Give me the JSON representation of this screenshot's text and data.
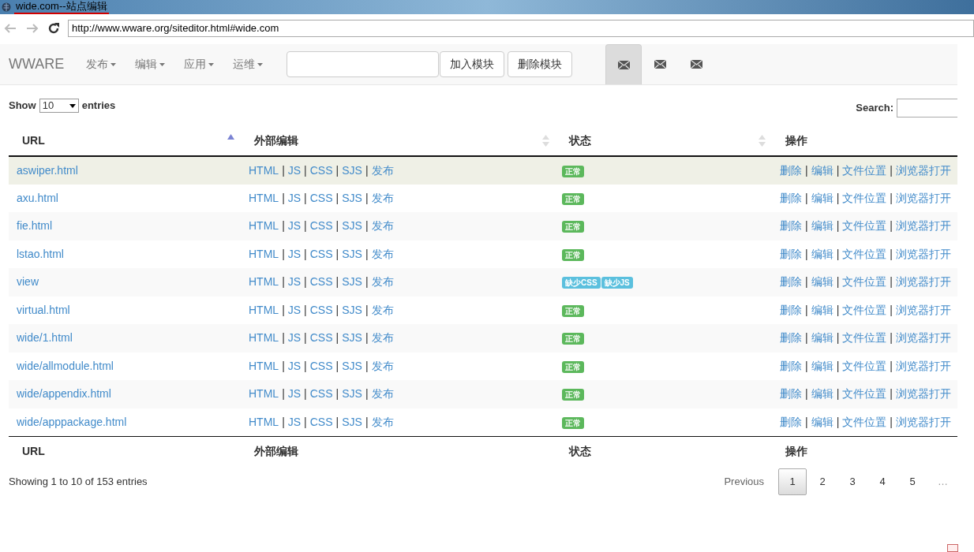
{
  "window": {
    "title": "wide.com--站点编辑"
  },
  "browser": {
    "url": "http://www.wware.org/siteditor.html#wide.com"
  },
  "navbar": {
    "brand": "WWARE",
    "menus": [
      "发布",
      "编辑",
      "应用",
      "运维"
    ],
    "buttons": [
      "加入模块",
      "删除模块"
    ],
    "icon_tabs": [
      {
        "selected": true
      },
      {
        "selected": false
      },
      {
        "selected": false
      }
    ]
  },
  "table_controls": {
    "show_label": "Show",
    "page_size": "10",
    "entries_label": "entries",
    "search_label": "Search:"
  },
  "table": {
    "columns": [
      {
        "label": "URL",
        "sortable": true,
        "sorted": true
      },
      {
        "label": "外部编辑",
        "sortable": true,
        "sorted": false
      },
      {
        "label": "状态",
        "sortable": true,
        "sorted": false
      },
      {
        "label": "操作",
        "sortable": false,
        "sorted": false
      }
    ],
    "link_separator": "|",
    "rows": [
      {
        "url": "aswiper.html",
        "highlighted": true,
        "edit_links": [
          "HTML",
          "JS",
          "CSS",
          "SJS",
          "发布"
        ],
        "status": [
          {
            "text": "正常",
            "kind": "success"
          }
        ],
        "actions": [
          "删除",
          "编辑",
          "文件位置",
          "浏览器打开"
        ]
      },
      {
        "url": "axu.html",
        "highlighted": false,
        "edit_links": [
          "HTML",
          "JS",
          "CSS",
          "SJS",
          "发布"
        ],
        "status": [
          {
            "text": "正常",
            "kind": "success"
          }
        ],
        "actions": [
          "删除",
          "编辑",
          "文件位置",
          "浏览器打开"
        ]
      },
      {
        "url": "fie.html",
        "highlighted": false,
        "edit_links": [
          "HTML",
          "JS",
          "CSS",
          "SJS",
          "发布"
        ],
        "status": [
          {
            "text": "正常",
            "kind": "success"
          }
        ],
        "actions": [
          "删除",
          "编辑",
          "文件位置",
          "浏览器打开"
        ]
      },
      {
        "url": "lstao.html",
        "highlighted": false,
        "edit_links": [
          "HTML",
          "JS",
          "CSS",
          "SJS",
          "发布"
        ],
        "status": [
          {
            "text": "正常",
            "kind": "success"
          }
        ],
        "actions": [
          "删除",
          "编辑",
          "文件位置",
          "浏览器打开"
        ]
      },
      {
        "url": "view",
        "highlighted": false,
        "edit_links": [
          "HTML",
          "JS",
          "CSS",
          "SJS",
          "发布"
        ],
        "status": [
          {
            "text": "缺少CSS",
            "kind": "info"
          },
          {
            "text": "缺少JS",
            "kind": "info"
          }
        ],
        "actions": [
          "删除",
          "编辑",
          "文件位置",
          "浏览器打开"
        ]
      },
      {
        "url": "virtual.html",
        "highlighted": false,
        "edit_links": [
          "HTML",
          "JS",
          "CSS",
          "SJS",
          "发布"
        ],
        "status": [
          {
            "text": "正常",
            "kind": "success"
          }
        ],
        "actions": [
          "删除",
          "编辑",
          "文件位置",
          "浏览器打开"
        ]
      },
      {
        "url": "wide/1.html",
        "highlighted": false,
        "edit_links": [
          "HTML",
          "JS",
          "CSS",
          "SJS",
          "发布"
        ],
        "status": [
          {
            "text": "正常",
            "kind": "success"
          }
        ],
        "actions": [
          "删除",
          "编辑",
          "文件位置",
          "浏览器打开"
        ]
      },
      {
        "url": "wide/allmodule.html",
        "highlighted": false,
        "edit_links": [
          "HTML",
          "JS",
          "CSS",
          "SJS",
          "发布"
        ],
        "status": [
          {
            "text": "正常",
            "kind": "success"
          }
        ],
        "actions": [
          "删除",
          "编辑",
          "文件位置",
          "浏览器打开"
        ]
      },
      {
        "url": "wide/appendix.html",
        "highlighted": false,
        "edit_links": [
          "HTML",
          "JS",
          "CSS",
          "SJS",
          "发布"
        ],
        "status": [
          {
            "text": "正常",
            "kind": "success"
          }
        ],
        "actions": [
          "删除",
          "编辑",
          "文件位置",
          "浏览器打开"
        ]
      },
      {
        "url": "wide/apppackage.html",
        "highlighted": false,
        "edit_links": [
          "HTML",
          "JS",
          "CSS",
          "SJS",
          "发布"
        ],
        "status": [
          {
            "text": "正常",
            "kind": "success"
          }
        ],
        "actions": [
          "删除",
          "编辑",
          "文件位置",
          "浏览器打开"
        ]
      }
    ],
    "footer_columns": [
      "URL",
      "外部编辑",
      "状态",
      "操作"
    ]
  },
  "table_info": "Showing 1 to 10 of 153 entries",
  "pagination": {
    "previous": "Previous",
    "pages": [
      {
        "label": "1",
        "selected": true
      },
      {
        "label": "2",
        "selected": false
      },
      {
        "label": "3",
        "selected": false
      },
      {
        "label": "4",
        "selected": false
      },
      {
        "label": "5",
        "selected": false
      }
    ],
    "ellipsis": "…"
  }
}
